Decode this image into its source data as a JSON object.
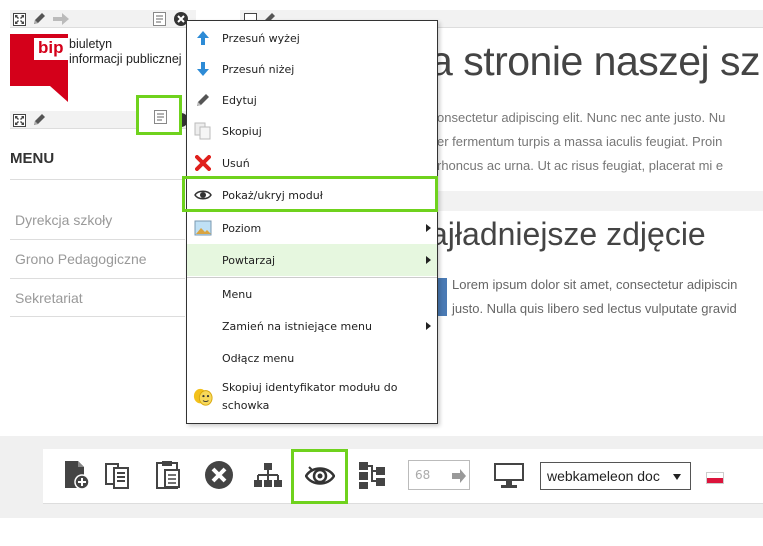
{
  "logo": {
    "mark": "bip",
    "line1": "biuletyn",
    "line2": "informacji publicznej"
  },
  "sidebar": {
    "menu_heading": "MENU",
    "items": [
      "Dyrekcja szkoły",
      "Grono Pedagogiczne",
      "Sekretariat"
    ]
  },
  "content": {
    "heading1": "a stronie naszej sz",
    "para1": [
      "onsectetur adipiscing elit. Nunc nec ante justo. Nu",
      "er fermentum turpis a massa iaculis feugiat. Proin",
      "rhoncus ac urna. Ut ac risus feugiat, placerat mi e"
    ],
    "heading2": "ajładniejsze zdjęcie",
    "para2": [
      "Lorem ipsum dolor sit amet, consectetur adipiscin",
      "justo. Nulla quis libero sed lectus vulputate gravid"
    ]
  },
  "context_menu": {
    "items": [
      {
        "label": "Przesuń wyżej",
        "icon": "arrow-up-icon"
      },
      {
        "label": "Przesuń niżej",
        "icon": "arrow-down-icon"
      },
      {
        "label": "Edytuj",
        "icon": "pencil-icon"
      },
      {
        "label": "Skopiuj",
        "icon": "copy-icon"
      },
      {
        "label": "Usuń",
        "icon": "delete-x-icon"
      },
      {
        "label": "Pokaż/ukryj moduł",
        "icon": "eye-icon"
      },
      {
        "label": "Poziom",
        "icon": "level-image-icon"
      },
      {
        "label": "Powtarzaj",
        "icon": ""
      },
      {
        "label": "Menu",
        "icon": ""
      },
      {
        "label": "Zamień na istniejące menu",
        "icon": ""
      },
      {
        "label": "Odłącz menu",
        "icon": ""
      },
      {
        "label": "Skopiuj identyfikator modułu do schowka",
        "icon": "masks-icon"
      }
    ]
  },
  "toolbar": {
    "page_number": "68",
    "site_select": "webkameleon doc",
    "icons": [
      "add-page-icon",
      "copy-page-icon",
      "paste-icon",
      "delete-icon",
      "sitemap-icon",
      "eye-icon",
      "structure-icon",
      "monitor-icon",
      "flag-poland-icon"
    ]
  },
  "colors": {
    "highlight": "#6fd21d",
    "bip_red": "#d4001a",
    "submenu_hover": "#e6f7df"
  }
}
